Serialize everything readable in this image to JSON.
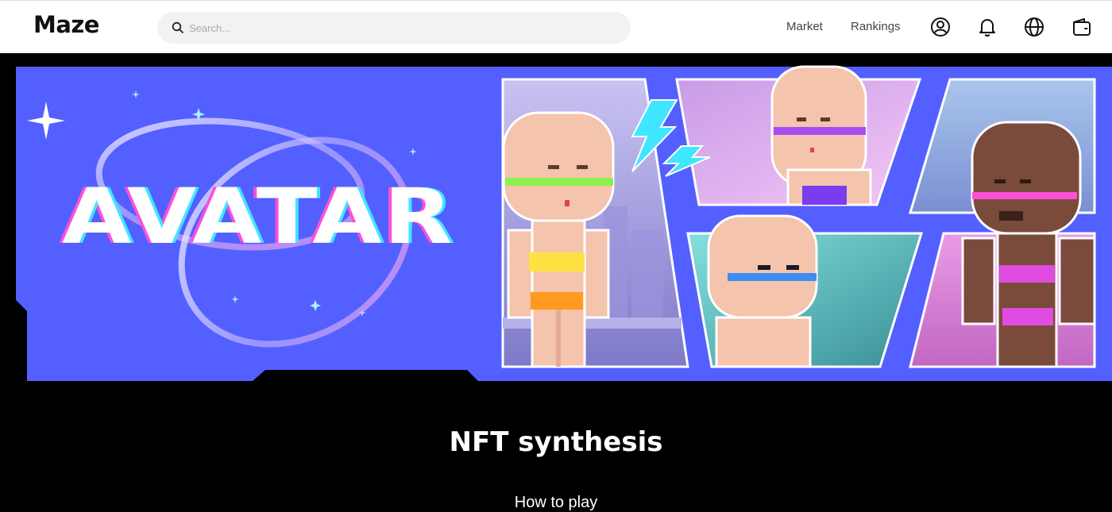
{
  "header": {
    "logo": "Maze",
    "search": {
      "placeholder": "Search..."
    },
    "nav": [
      {
        "label": "Market"
      },
      {
        "label": "Rankings"
      }
    ],
    "icons": [
      "user-icon",
      "bell-icon",
      "globe-icon",
      "wallet-icon"
    ]
  },
  "banner": {
    "title": "AVATAR",
    "colors": {
      "background": "#5360ff",
      "accent_pink": "#ff4fd8",
      "accent_cyan": "#3fe6ff"
    }
  },
  "main": {
    "title": "NFT synthesis",
    "how_to_play": "How to play"
  }
}
